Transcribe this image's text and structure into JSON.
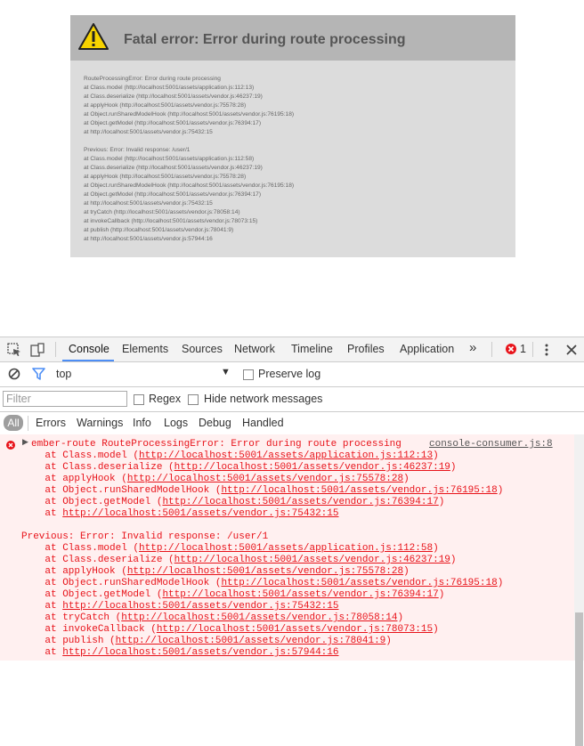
{
  "error_page": {
    "title": "Fatal error: Error during route processing",
    "block1": [
      "RouteProcessingError: Error during route processing",
      "at Class.model (http://localhost:5001/assets/application.js:112:13)",
      "at Class.deserialize (http://localhost:5001/assets/vendor.js:46237:19)",
      "at applyHook (http://localhost:5001/assets/vendor.js:75578:28)",
      "at Object.runSharedModelHook (http://localhost:5001/assets/vendor.js:76195:18)",
      "at Object.getModel (http://localhost:5001/assets/vendor.js:76394:17)",
      "at http://localhost:5001/assets/vendor.js:75432:15"
    ],
    "block2": [
      "Previous: Error: Invalid response: /user/1",
      "at Class.model (http://localhost:5001/assets/application.js:112:58)",
      "at Class.deserialize (http://localhost:5001/assets/vendor.js:46237:19)",
      "at applyHook (http://localhost:5001/assets/vendor.js:75578:28)",
      "at Object.runSharedModelHook (http://localhost:5001/assets/vendor.js:76195:18)",
      "at Object.getModel (http://localhost:5001/assets/vendor.js:76394:17)",
      "at http://localhost:5001/assets/vendor.js:75432:15",
      "at tryCatch (http://localhost:5001/assets/vendor.js:78058:14)",
      "at invokeCallback (http://localhost:5001/assets/vendor.js:78073:15)",
      "at publish (http://localhost:5001/assets/vendor.js:78041:9)",
      "at http://localhost:5001/assets/vendor.js:57944:16"
    ]
  },
  "devtools": {
    "tabs": [
      "Console",
      "Elements",
      "Sources",
      "Network",
      "Timeline",
      "Profiles",
      "Application"
    ],
    "more": "»",
    "error_count": "1",
    "context": "top",
    "preserve_log": "Preserve log",
    "filter_placeholder": "Filter",
    "regex": "Regex",
    "hide_network": "Hide network messages",
    "levels": [
      "All",
      "Errors",
      "Warnings",
      "Info",
      "Logs",
      "Debug",
      "Handled"
    ],
    "console": {
      "head_prefix": "ember-route RouteProcessingError: Error during route processing",
      "source": "console-consumer.js:8",
      "frames1": [
        {
          "pre": "    at Class.model (",
          "url": "http://localhost:5001/assets/application.js:112:13",
          "post": ")"
        },
        {
          "pre": "    at Class.deserialize (",
          "url": "http://localhost:5001/assets/vendor.js:46237:19",
          "post": ")"
        },
        {
          "pre": "    at applyHook (",
          "url": "http://localhost:5001/assets/vendor.js:75578:28",
          "post": ")"
        },
        {
          "pre": "    at Object.runSharedModelHook (",
          "url": "http://localhost:5001/assets/vendor.js:76195:18",
          "post": ")"
        },
        {
          "pre": "    at Object.getModel (",
          "url": "http://localhost:5001/assets/vendor.js:76394:17",
          "post": ")"
        },
        {
          "pre": "    at ",
          "url": "http://localhost:5001/assets/vendor.js:75432:15",
          "post": ""
        }
      ],
      "previous": "Previous: Error: Invalid response: /user/1",
      "frames2": [
        {
          "pre": "    at Class.model (",
          "url": "http://localhost:5001/assets/application.js:112:58",
          "post": ")"
        },
        {
          "pre": "    at Class.deserialize (",
          "url": "http://localhost:5001/assets/vendor.js:46237:19",
          "post": ")"
        },
        {
          "pre": "    at applyHook (",
          "url": "http://localhost:5001/assets/vendor.js:75578:28",
          "post": ")"
        },
        {
          "pre": "    at Object.runSharedModelHook (",
          "url": "http://localhost:5001/assets/vendor.js:76195:18",
          "post": ")"
        },
        {
          "pre": "    at Object.getModel (",
          "url": "http://localhost:5001/assets/vendor.js:76394:17",
          "post": ")"
        },
        {
          "pre": "    at ",
          "url": "http://localhost:5001/assets/vendor.js:75432:15",
          "post": ""
        },
        {
          "pre": "    at tryCatch (",
          "url": "http://localhost:5001/assets/vendor.js:78058:14",
          "post": ")"
        },
        {
          "pre": "    at invokeCallback (",
          "url": "http://localhost:5001/assets/vendor.js:78073:15",
          "post": ")"
        },
        {
          "pre": "    at publish (",
          "url": "http://localhost:5001/assets/vendor.js:78041:9",
          "post": ")"
        },
        {
          "pre": "    at ",
          "url": "http://localhost:5001/assets/vendor.js:57944:16",
          "post": ""
        }
      ]
    }
  }
}
